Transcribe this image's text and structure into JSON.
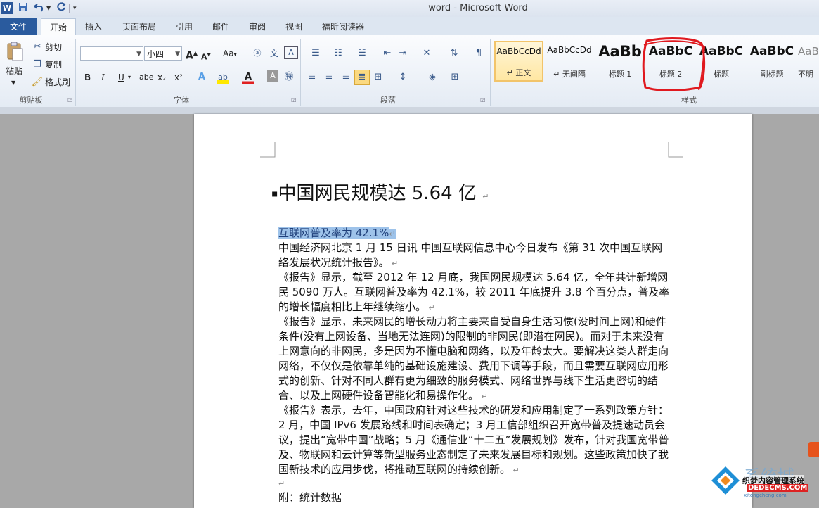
{
  "window": {
    "app_icon": "W",
    "title": "word  -  Microsoft Word"
  },
  "qat": {
    "save": "save-icon",
    "undo": "undo-icon",
    "redo": "redo-icon"
  },
  "tabs": [
    {
      "label": "文件"
    },
    {
      "label": "开始"
    },
    {
      "label": "插入"
    },
    {
      "label": "页面布局"
    },
    {
      "label": "引用"
    },
    {
      "label": "邮件"
    },
    {
      "label": "审阅"
    },
    {
      "label": "视图"
    },
    {
      "label": "福昕阅读器"
    }
  ],
  "clipboard": {
    "paste": "粘贴",
    "cut": "剪切",
    "copy": "复制",
    "format_painter": "格式刷",
    "label": "剪贴板"
  },
  "font": {
    "font_name": "",
    "font_size": "小四",
    "label": "字体",
    "grow": "A",
    "shrink": "A",
    "case": "Aa",
    "bold": "B",
    "italic": "I",
    "underline": "U",
    "strike": "abe",
    "subscript": "x₂",
    "superscript": "x²"
  },
  "paragraph": {
    "label": "段落"
  },
  "styles": {
    "label": "样式",
    "items": [
      {
        "sample": "AaBbCcDd",
        "name": "↵ 正文"
      },
      {
        "sample": "AaBbCcDd",
        "name": "↵ 无间隔"
      },
      {
        "sample": "AaBb",
        "name": "标题 1"
      },
      {
        "sample": "AaBbC",
        "name": "标题 2"
      },
      {
        "sample": "AaBbC",
        "name": "标题"
      },
      {
        "sample": "AaBbC",
        "name": "副标题"
      },
      {
        "sample": "AaBb",
        "name": "不明"
      }
    ]
  },
  "document": {
    "heading": "中国网民规模达 5.64 亿",
    "subheading": "互联网普及率为 42.1%",
    "paragraphs": [
      "中国经济网北京 1 月 15 日讯  中国互联网信息中心今日发布《第 31 次中国互联网络发展状况统计报告》。",
      "《报告》显示，截至 2012 年 12 月底，我国网民规模达 5.64 亿，全年共计新增网民 5090 万人。互联网普及率为 42.1%，较 2011 年底提升 3.8 个百分点，普及率的增长幅度相比上年继续缩小。",
      "《报告》显示，未来网民的增长动力将主要来自受自身生活习惯(没时间上网)和硬件条件(没有上网设备、当地无法连网)的限制的非网民(即潜在网民)。而对于未来没有上网意向的非网民，多是因为不懂电脑和网络，以及年龄太大。要解决这类人群走向网络，不仅仅是依靠单纯的基础设施建设、费用下调等手段，而且需要互联网应用形式的创新、针对不同人群有更为细致的服务模式、网络世界与线下生活更密切的结合、以及上网硬件设备智能化和易操作化。",
      "《报告》表示，去年，中国政府针对这些技术的研发和应用制定了一系列政策方针：2 月，中国 IPv6 发展路线和时间表确定；3 月工信部组织召开宽带普及提速动员会议，提出“宽带中国”战略；5 月《通信业“十二五”发展规划》发布，针对我国宽带普及、物联网和云计算等新型服务业态制定了未来发展目标和规划。这些政策加快了我国新技术的应用步伐，将推动互联网的持续创新。"
    ],
    "appendix": "附：统计数据"
  },
  "watermark": {
    "brand": "系统城",
    "line1": "织梦内容管理系统",
    "line2": "DEDECMS.COM",
    "line3": "xitongcheng.com"
  }
}
